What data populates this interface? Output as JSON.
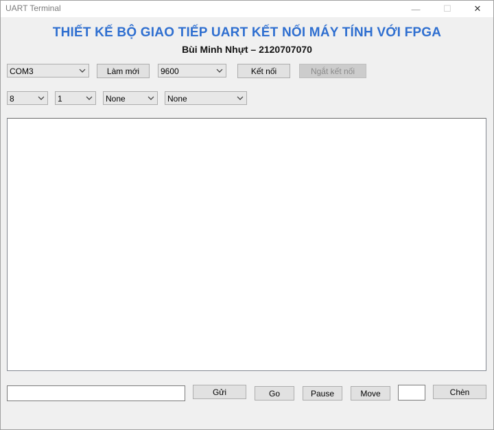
{
  "window": {
    "title": "UART Terminal",
    "minimize": "—",
    "maximize": "☐",
    "close": "✕"
  },
  "header": {
    "title": "THIẾT KẾ BỘ GIAO TIẾP UART KẾT NỐI MÁY TÍNH VỚI FPGA",
    "subtitle": "Bùi Minh Nhựt – 2120707070"
  },
  "connection": {
    "port": "COM3",
    "refresh_label": "Làm mới",
    "baud": "9600",
    "connect_label": "Kết nối",
    "disconnect_label": "Ngắt kết nối"
  },
  "settings": {
    "data_bits": "8",
    "stop_bits": "1",
    "parity": "None",
    "flow_control": "None"
  },
  "terminal": {
    "content": ""
  },
  "footer": {
    "message_value": "",
    "send_label": "Gửi",
    "go_label": "Go",
    "pause_label": "Pause",
    "move_label": "Move",
    "insert_value": "",
    "insert_label": "Chèn"
  }
}
